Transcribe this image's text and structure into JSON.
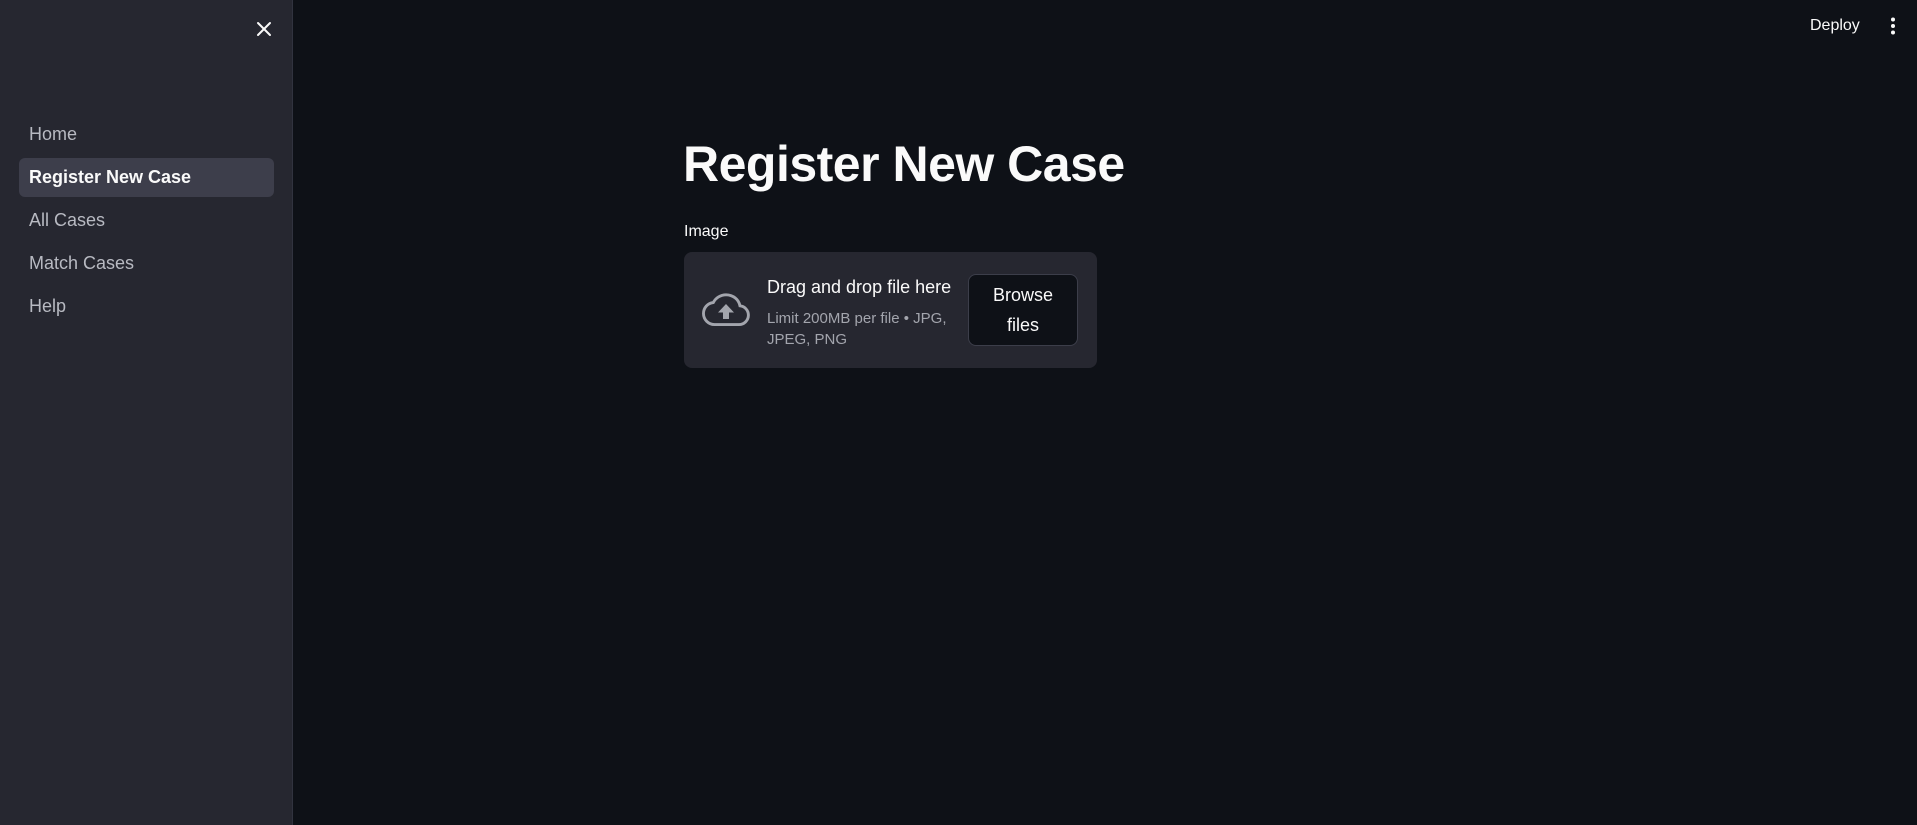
{
  "sidebar": {
    "items": [
      {
        "label": "Home"
      },
      {
        "label": "Register New Case"
      },
      {
        "label": "All Cases"
      },
      {
        "label": "Match Cases"
      },
      {
        "label": "Help"
      }
    ],
    "active_item": "Register New Case",
    "close_icon": "close-icon"
  },
  "header": {
    "deploy_label": "Deploy",
    "menu_icon": "more-vertical-icon"
  },
  "main": {
    "title": "Register New Case",
    "uploader": {
      "label": "Image",
      "drop_text": "Drag and drop file here",
      "limit_text": "Limit 200MB per file • JPG, JPEG, PNG",
      "browse_label": "Browse files",
      "icon": "cloud-upload-icon"
    }
  },
  "colors": {
    "background": "#0e1117",
    "sidebar": "#262730",
    "active_nav": "#3d3e4b",
    "text": "#fafafa",
    "muted_text": "#a3a5ad"
  }
}
